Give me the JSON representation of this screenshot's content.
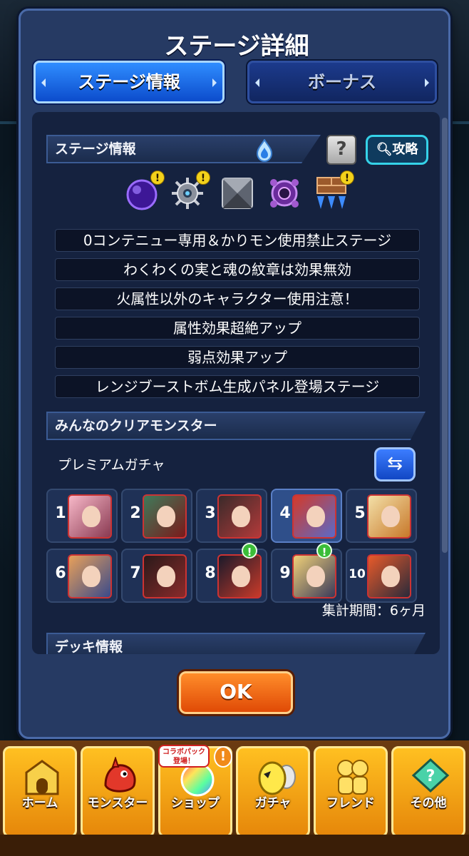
{
  "modal": {
    "title": "ステージ詳細",
    "tabs": [
      {
        "label": "ステージ情報",
        "active": true
      },
      {
        "label": "ボーナス",
        "active": false
      }
    ]
  },
  "stage_info": {
    "header": "ステージ情報",
    "help_icon": "?",
    "strategy_label": "攻略",
    "gimmicks": [
      {
        "icon": "dark-orb-icon",
        "alert": true
      },
      {
        "icon": "spike-mine-icon",
        "alert": true
      },
      {
        "icon": "block-icon",
        "alert": false
      },
      {
        "icon": "warp-device-icon",
        "alert": false
      },
      {
        "icon": "damage-wall-icon",
        "alert": true
      }
    ],
    "rules": [
      "0コンテニュー専用＆かりモン使用禁止ステージ",
      "わくわくの実と魂の紋章は効果無効",
      "火属性以外のキャラクター使用注意！",
      "属性効果超絶アップ",
      "弱点効果アップ",
      "レンジブーストボム生成パネル登場ステージ"
    ]
  },
  "clear_monsters": {
    "header": "みんなのクリアモンスター",
    "gacha_label": "プレミアムガチャ",
    "ranks": [
      "1",
      "2",
      "3",
      "4",
      "5",
      "6",
      "7",
      "8",
      "9",
      "10"
    ],
    "period": "集計期間：6ヶ月"
  },
  "deck_info": {
    "header": "デッキ情報"
  },
  "ok_label": "OK",
  "nav": {
    "collab_badge": "コラボパック登場！",
    "items": [
      {
        "label": "ホーム",
        "icon": "home-icon"
      },
      {
        "label": "モンスター",
        "icon": "monster-icon"
      },
      {
        "label": "ショップ",
        "icon": "shop-icon"
      },
      {
        "label": "ガチャ",
        "icon": "gacha-icon"
      },
      {
        "label": "フレンド",
        "icon": "friend-icon"
      },
      {
        "label": "その他",
        "icon": "other-icon"
      }
    ]
  },
  "colors": {
    "modal_bg": "#263a63",
    "tab_active": "#2f8dff",
    "ok_button": "#ff8d2a",
    "nav_button": "#ffc021",
    "strategy_border": "#35d2e8"
  }
}
